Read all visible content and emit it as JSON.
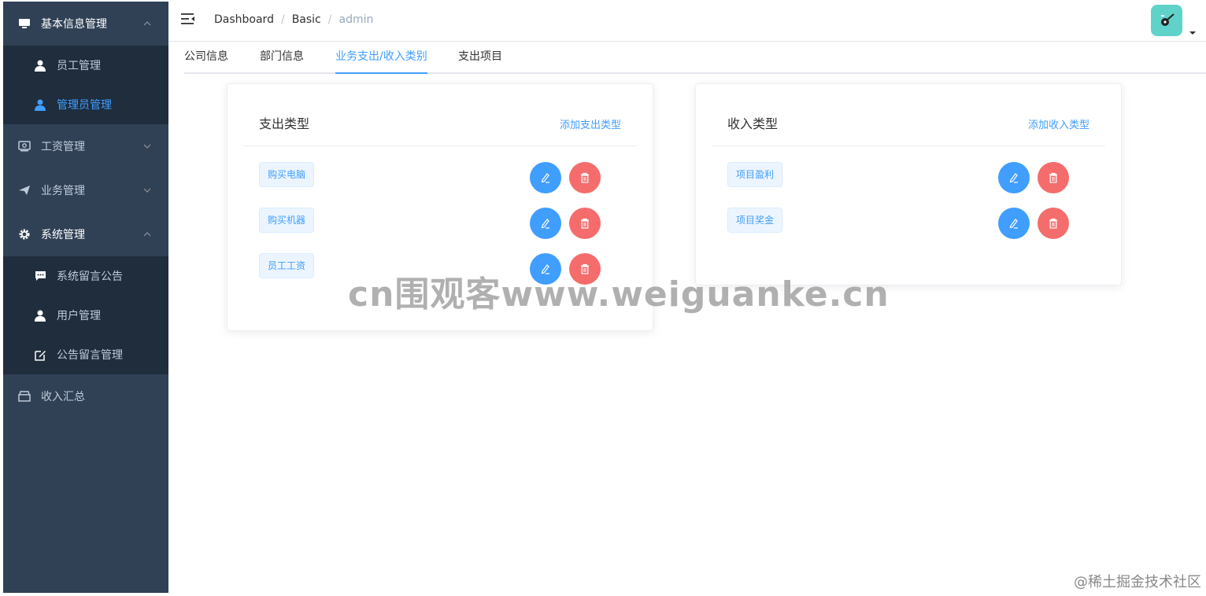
{
  "sidebar": {
    "groups": [
      {
        "label": "基本信息管理",
        "icon": "monitor-icon",
        "expanded": true,
        "items": [
          {
            "label": "员工管理",
            "icon": "user-icon"
          },
          {
            "label": "管理员管理",
            "icon": "user-icon",
            "active": true
          }
        ]
      },
      {
        "label": "工资管理",
        "icon": "money-icon",
        "expanded": false
      },
      {
        "label": "业务管理",
        "icon": "send-icon",
        "expanded": false
      },
      {
        "label": "系统管理",
        "icon": "gear-icon",
        "expanded": true,
        "items": [
          {
            "label": "系统留言公告",
            "icon": "message-icon"
          },
          {
            "label": "用户管理",
            "icon": "user-icon"
          },
          {
            "label": "公告留言管理",
            "icon": "edit-icon"
          }
        ]
      },
      {
        "label": "收入汇总",
        "icon": "box-icon"
      }
    ]
  },
  "breadcrumb": [
    "Dashboard",
    "Basic",
    "admin"
  ],
  "tabs": [
    {
      "label": "公司信息"
    },
    {
      "label": "部门信息"
    },
    {
      "label": "业务支出/收入类别",
      "active": true
    },
    {
      "label": "支出项目"
    }
  ],
  "expense_card": {
    "title": "支出类型",
    "add_label": "添加支出类型",
    "items": [
      "购买电脑",
      "购买机器",
      "员工工资"
    ]
  },
  "income_card": {
    "title": "收入类型",
    "add_label": "添加收入类型",
    "items": [
      "项目盈利",
      "项目奖金"
    ]
  },
  "watermark": "cn围观客www.weiguanke.cn",
  "corner_watermark": "@稀土掘金技术社区",
  "colors": {
    "sidebar_bg": "#304156",
    "submenu_bg": "#1f2d3d",
    "primary": "#409eff",
    "danger": "#f56c6c",
    "avatar_bg": "#5fd3c9"
  }
}
